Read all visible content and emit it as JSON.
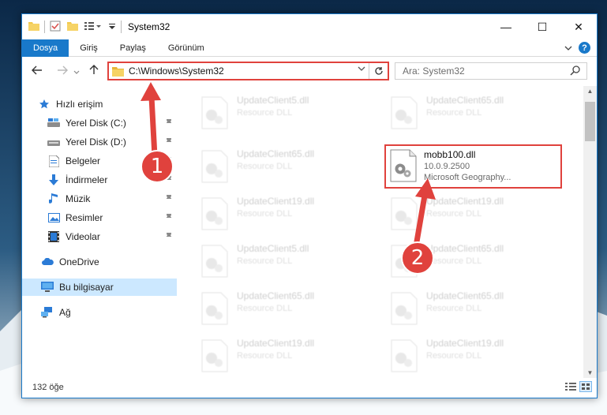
{
  "window": {
    "title": "System32",
    "controls": {
      "minimize": "—",
      "maximize": "☐",
      "close": "✕"
    }
  },
  "ribbon": {
    "tabs": [
      "Dosya",
      "Giriş",
      "Paylaş",
      "Görünüm"
    ],
    "expand_icon": "chevron-down-icon",
    "help": "?"
  },
  "address": {
    "path": "C:\\Windows\\System32",
    "search_placeholder": "Ara: System32"
  },
  "nav": {
    "quick_access": "Hızlı erişim",
    "items": [
      {
        "label": "Yerel Disk (C:)",
        "icon": "drive-icon",
        "pinned": true
      },
      {
        "label": "Yerel Disk (D:)",
        "icon": "drive-icon",
        "pinned": true
      },
      {
        "label": "Belgeler",
        "icon": "documents-icon",
        "pinned": true
      },
      {
        "label": "İndirmeler",
        "icon": "download-icon",
        "pinned": true
      },
      {
        "label": "Müzik",
        "icon": "music-icon",
        "pinned": true
      },
      {
        "label": "Resimler",
        "icon": "pictures-icon",
        "pinned": true
      },
      {
        "label": "Videolar",
        "icon": "video-icon",
        "pinned": true
      }
    ],
    "onedrive": "OneDrive",
    "this_pc": "Bu bilgisayar",
    "network": "Ağ"
  },
  "files": {
    "left_column": [
      {
        "name": "UpdateClient5.dll",
        "type": "Resource DLL"
      },
      {
        "name": "UpdateClient65.dll",
        "type": "Resource DLL"
      },
      {
        "name": "UpdateClient19.dll",
        "type": "Resource DLL"
      },
      {
        "name": "UpdateClient5.dll",
        "type": "Resource DLL"
      },
      {
        "name": "UpdateClient65.dll",
        "type": "Resource DLL"
      },
      {
        "name": "UpdateClient19.dll",
        "type": "Resource DLL"
      }
    ],
    "right_column": [
      {
        "name": "UpdateClient65.dll",
        "type": "Resource DLL"
      },
      {
        "name": "UpdateClient19.dll",
        "type": "Resource DLL"
      },
      {
        "name": "UpdateClient65.dll",
        "type": "Resource DLL"
      },
      {
        "name": "UpdateClient65.dll",
        "type": "Resource DLL"
      },
      {
        "name": "UpdateClient19.dll",
        "type": "Resource DLL"
      }
    ],
    "highlighted": {
      "name": "mobb100.dll",
      "version": "10.0.9.2500",
      "description": "Microsoft Geography..."
    }
  },
  "status": {
    "count": "132 öğe"
  },
  "markers": {
    "one": "1",
    "two": "2"
  },
  "colors": {
    "accent": "#1979ca",
    "highlight": "#e0423d"
  }
}
